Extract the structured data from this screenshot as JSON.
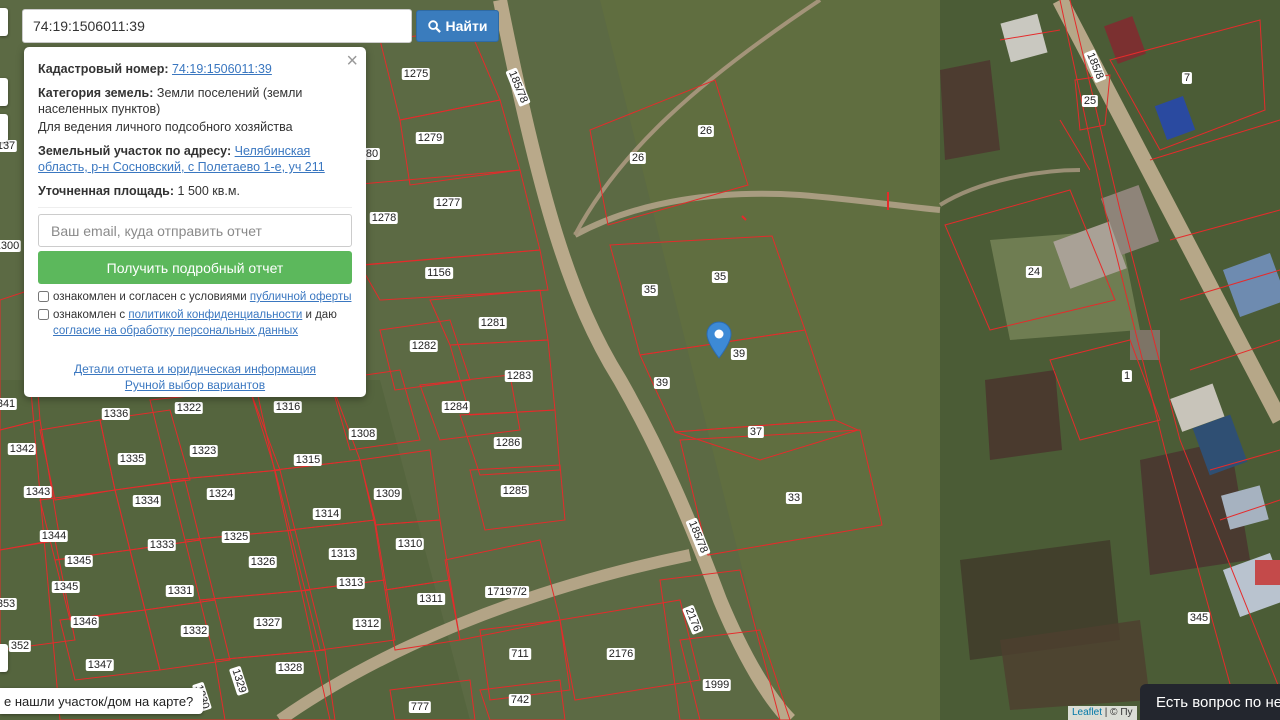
{
  "search": {
    "value": "74:19:1506011:39",
    "button_label": "Найти"
  },
  "popup": {
    "cadastral_label": "Кадастровый номер:",
    "cadastral_value": "74:19:1506011:39",
    "category_label": "Категория земель:",
    "category_value": "Земли поселений (земли населенных пунктов)",
    "usage": "Для ведения личного подсобного хозяйства",
    "address_label": "Земельный участок по адресу:",
    "address_value": "Челябинская область, р-н Сосновский, с Полетаево 1-е, уч 211",
    "area_label": "Уточненная площадь:",
    "area_value": "1 500 кв.м.",
    "email_placeholder": "Ваш email, куда отправить отчет",
    "report_button": "Получить подробный отчет",
    "check1_text": "ознакомлен и согласен с условиями ",
    "check1_link": "публичной оферты",
    "check2_text": "ознакомлен с ",
    "check2_link": "политикой конфиденциальности",
    "check2_mid": " и даю ",
    "check2_link2": "согласие на обработку персональных данных",
    "details_link": "Детали отчета и юридическая информация",
    "manual_link": "Ручной выбор вариантов"
  },
  "bottom": {
    "not_found": "е нашли участок/дом на карте?",
    "chat": "Есть вопрос по не",
    "attrib_leaflet": "Leaflet",
    "attrib_rest": " | © Пу"
  },
  "plot_labels": [
    "1275",
    "1279",
    "80",
    "1278",
    "1277",
    "1156",
    "1281",
    "1282",
    "1283",
    "1284",
    "1286",
    "1285",
    "1300",
    "137",
    "1316",
    "1308",
    "1322",
    "1336",
    "1342",
    "1335",
    "1323",
    "1315",
    "1343",
    "1334",
    "1324",
    "1309",
    "1314",
    "1344",
    "1333",
    "1325",
    "1310",
    "1313",
    "1345",
    "1326",
    "1345",
    "1331",
    "1313",
    "1311",
    "17197/2",
    "1346",
    "1327",
    "1332",
    "1312",
    "1347",
    "1328",
    "1329",
    "1330",
    "352",
    "353",
    "341",
    "711",
    "742",
    "777",
    "2176",
    "2176",
    "1999",
    "26",
    "26",
    "35",
    "35",
    "39",
    "39",
    "37",
    "33",
    "24",
    "25",
    "7",
    "1",
    "345",
    "185/78",
    "185/78",
    "185/8"
  ],
  "colors": {
    "boundary": "#e52b2b",
    "accent_blue": "#3a7cbd",
    "report_green": "#5cb85c",
    "marker_blue": "#3d8ad6"
  }
}
